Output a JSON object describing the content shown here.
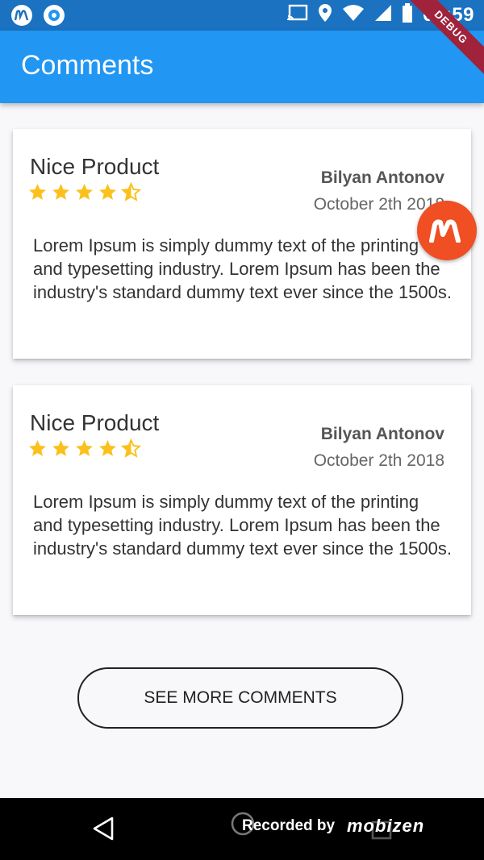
{
  "status_bar": {
    "time": "03:59",
    "left_icons": [
      "mobizen-icon",
      "circle-icon"
    ],
    "right_icons": [
      "cast-icon",
      "location-icon",
      "wifi-icon",
      "signal-icon",
      "battery-icon"
    ]
  },
  "app_bar": {
    "title": "Comments"
  },
  "debug_banner": {
    "label": "DEBUG"
  },
  "comments": [
    {
      "product": "Nice Product",
      "rating": 4.5,
      "author": "Bilyan Antonov",
      "date": "October 2th 2018",
      "body": "Lorem Ipsum is simply dummy text of the printing and typesetting industry. Lorem Ipsum has been the industry's standard dummy text ever since the 1500s."
    },
    {
      "product": "Nice Product",
      "rating": 4.5,
      "author": "Bilyan Antonov",
      "date": "October 2th 2018",
      "body": "Lorem Ipsum is simply dummy text of the printing and typesetting industry. Lorem Ipsum has been the industry's standard dummy text ever since the 1500s."
    }
  ],
  "see_more_label": "SEE MORE COMMENTS",
  "nav_bar": {
    "recorded_label": "Recorded by",
    "brand": "mobizen"
  },
  "colors": {
    "app_bar": "#2196f3",
    "status_bar": "#1a72c0",
    "star": "#fbc01b",
    "debug": "#a0223b",
    "fab": "#f04e23"
  }
}
